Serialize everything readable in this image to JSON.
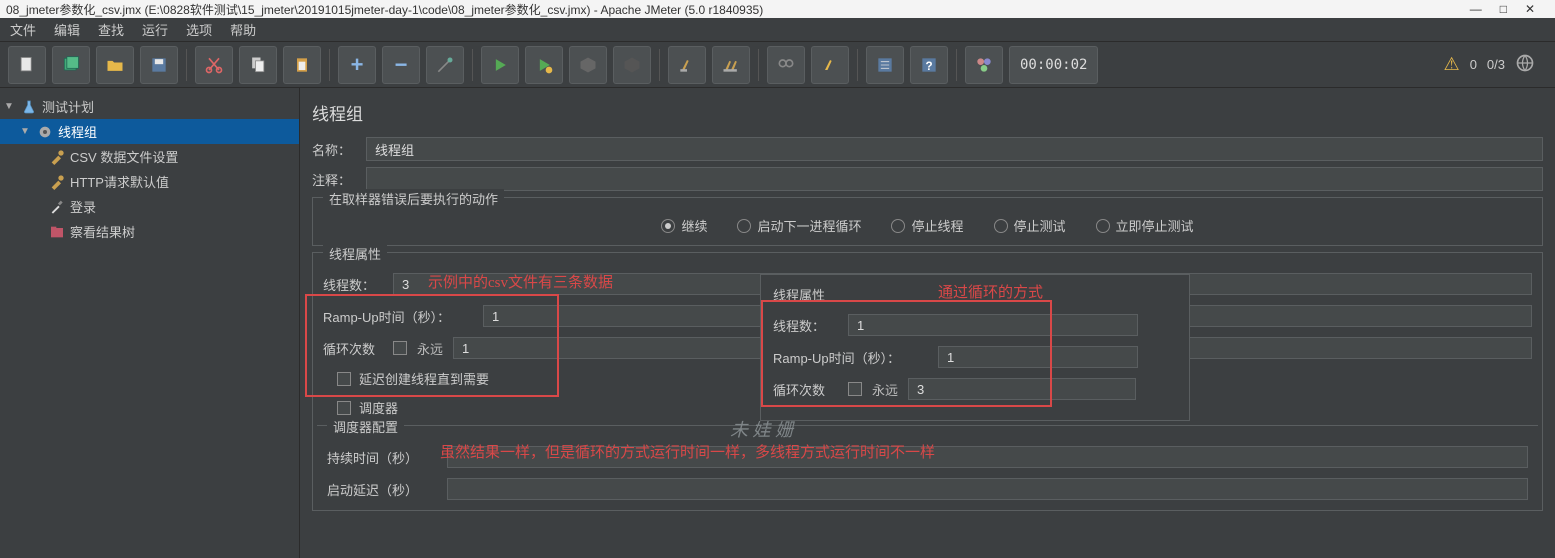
{
  "window": {
    "title": "08_jmeter参数化_csv.jmx (E:\\0828软件测试\\15_jmeter\\20191015jmeter-day-1\\code\\08_jmeter参数化_csv.jmx) - Apache JMeter (5.0 r1840935)"
  },
  "menubar": [
    "文件",
    "编辑",
    "查找",
    "运行",
    "选项",
    "帮助"
  ],
  "toolbar": {
    "timer": "00:00:02",
    "warn_count": "0",
    "thread_ratio": "0/3"
  },
  "tree": {
    "test_plan": "测试计划",
    "thread_group": "线程组",
    "csv_config": "CSV 数据文件设置",
    "http_defaults": "HTTP请求默认值",
    "login": "登录",
    "view_tree": "察看结果树"
  },
  "panel": {
    "title": "线程组",
    "name_label": "名称：",
    "name_value": "线程组",
    "comment_label": "注释：",
    "comment_value": "",
    "sampler_error_title": "在取样器错误后要执行的动作",
    "radios": {
      "continue": "继续",
      "start_next": "启动下一进程循环",
      "stop_thread": "停止线程",
      "stop_test": "停止测试",
      "stop_now": "立即停止测试"
    },
    "thread_props_title": "线程属性",
    "threads_label": "线程数：",
    "threads_value": "3",
    "rampup_label": "Ramp-Up时间（秒）：",
    "rampup_value": "1",
    "loop_label": "循环次数",
    "forever_label": "永远",
    "loop_value": "1",
    "delay_create_label": "延迟创建线程直到需要",
    "scheduler_label": "调度器",
    "scheduler_config_title": "调度器配置",
    "duration_label": "持续时间（秒）",
    "startup_delay_label": "启动延迟（秒）"
  },
  "overlay": {
    "thread_props_title": "线程属性",
    "threads_label": "线程数：",
    "threads_value": "1",
    "rampup_label": "Ramp-Up时间（秒）：",
    "rampup_value": "1",
    "loop_label": "循环次数",
    "forever_label": "永远",
    "loop_value": "3"
  },
  "annotations": {
    "left": "示例中的csv文件有三条数据",
    "right": "通过循环的方式",
    "bottom": "虽然结果一样，但是循环的方式运行时间一样，多线程方式运行时间不一样"
  },
  "watermark": "未 娃 姗"
}
